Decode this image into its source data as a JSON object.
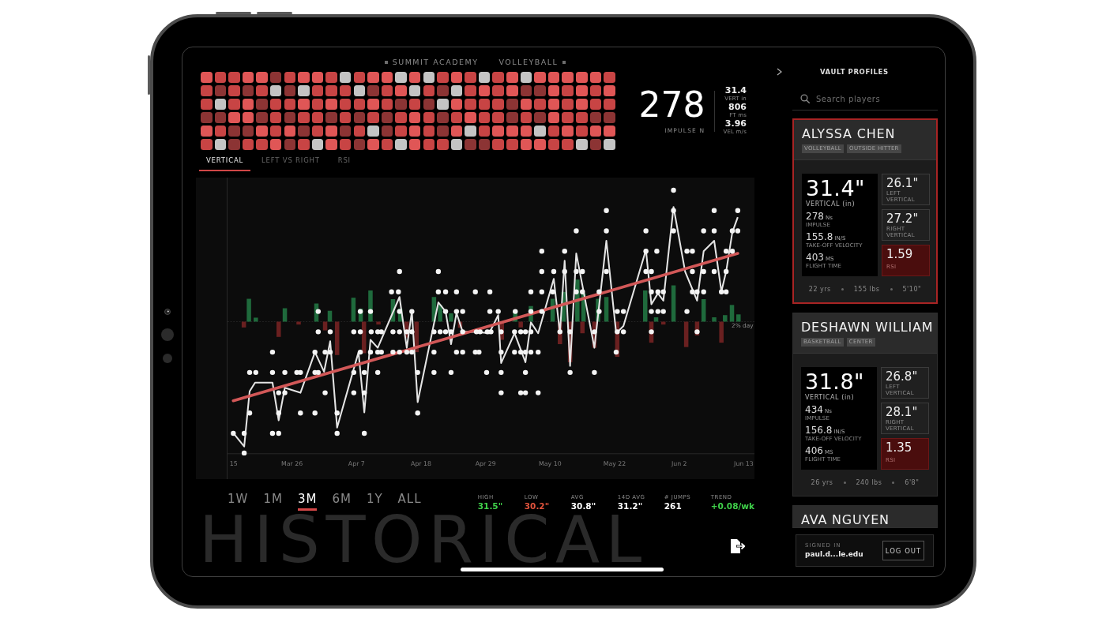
{
  "header": {
    "school": "SUMMIT ACADEMY",
    "sport": "VOLLEYBALL"
  },
  "heatmap": {
    "rows": [
      {
        "cells": [
          {
            "color": "#e05656"
          },
          {
            "color": "#c84444"
          },
          {
            "color": "#c84444"
          },
          {
            "color": "#e05656"
          },
          {
            "color": "#e05656"
          },
          {
            "color": "#8c3434"
          },
          {
            "color": "#c84444"
          },
          {
            "color": "#e05656"
          },
          {
            "color": "#e05656"
          },
          {
            "color": "#c84444"
          },
          {
            "color": "#c4c4c4"
          },
          {
            "color": "#c84444"
          },
          {
            "color": "#e05656"
          },
          {
            "color": "#e05656"
          },
          {
            "color": "#c4c4c4"
          },
          {
            "color": "#e05656"
          },
          {
            "color": "#c4c4c4"
          },
          {
            "color": "#c84444"
          },
          {
            "color": "#e05656"
          },
          {
            "color": "#c84444"
          },
          {
            "color": "#c4c4c4"
          },
          {
            "color": "#c84444"
          },
          {
            "color": "#e05656"
          },
          {
            "color": "#c4c4c4"
          },
          {
            "color": "#e05656"
          },
          {
            "color": "#e05656"
          },
          {
            "color": "#e05656"
          },
          {
            "color": "#e05656"
          },
          {
            "color": "#e05656"
          },
          {
            "color": "#c84444"
          }
        ]
      },
      {
        "cells": [
          {
            "color": "#c84444"
          },
          {
            "color": "#8c3434"
          },
          {
            "color": "#c84444"
          },
          {
            "color": "#8c3434"
          },
          {
            "color": "#c84444"
          },
          {
            "color": "#c4c4c4"
          },
          {
            "color": "#8c3434"
          },
          {
            "color": "#c4c4c4"
          },
          {
            "color": "#c84444"
          },
          {
            "color": "#c84444"
          },
          {
            "color": "#c84444"
          },
          {
            "color": "#c4c4c4"
          },
          {
            "color": "#8c3434"
          },
          {
            "color": "#c84444"
          },
          {
            "color": "#e05656"
          },
          {
            "color": "#c4c4c4"
          },
          {
            "color": "#c84444"
          },
          {
            "color": "#8c3434"
          },
          {
            "color": "#c4c4c4"
          },
          {
            "color": "#c84444"
          },
          {
            "color": "#e05656"
          },
          {
            "color": "#c84444"
          },
          {
            "color": "#e05656"
          },
          {
            "color": "#8c3434"
          },
          {
            "color": "#8c3434"
          },
          {
            "color": "#e05656"
          },
          {
            "color": "#c84444"
          },
          {
            "color": "#e05656"
          },
          {
            "color": "#c84444"
          },
          {
            "color": "#e05656"
          }
        ]
      },
      {
        "cells": [
          {
            "color": "#c84444"
          },
          {
            "color": "#c4c4c4"
          },
          {
            "color": "#c84444"
          },
          {
            "color": "#e05656"
          },
          {
            "color": "#8c3434"
          },
          {
            "color": "#c84444"
          },
          {
            "color": "#c84444"
          },
          {
            "color": "#e05656"
          },
          {
            "color": "#c84444"
          },
          {
            "color": "#e05656"
          },
          {
            "color": "#c84444"
          },
          {
            "color": "#c84444"
          },
          {
            "color": "#e05656"
          },
          {
            "color": "#c84444"
          },
          {
            "color": "#8c3434"
          },
          {
            "color": "#c84444"
          },
          {
            "color": "#8c3434"
          },
          {
            "color": "#c4c4c4"
          },
          {
            "color": "#e05656"
          },
          {
            "color": "#c84444"
          },
          {
            "color": "#c84444"
          },
          {
            "color": "#c84444"
          },
          {
            "color": "#8c3434"
          },
          {
            "color": "#e05656"
          },
          {
            "color": "#c84444"
          },
          {
            "color": "#e05656"
          },
          {
            "color": "#c84444"
          },
          {
            "color": "#e05656"
          },
          {
            "color": "#c84444"
          },
          {
            "color": "#c84444"
          }
        ]
      },
      {
        "cells": [
          {
            "color": "#8c3434"
          },
          {
            "color": "#8c3434"
          },
          {
            "color": "#e05656"
          },
          {
            "color": "#e05656"
          },
          {
            "color": "#8c3434"
          },
          {
            "color": "#c84444"
          },
          {
            "color": "#8c3434"
          },
          {
            "color": "#c84444"
          },
          {
            "color": "#c84444"
          },
          {
            "color": "#8c3434"
          },
          {
            "color": "#c84444"
          },
          {
            "color": "#8c3434"
          },
          {
            "color": "#c84444"
          },
          {
            "color": "#8c3434"
          },
          {
            "color": "#c84444"
          },
          {
            "color": "#e05656"
          },
          {
            "color": "#c84444"
          },
          {
            "color": "#8c3434"
          },
          {
            "color": "#c84444"
          },
          {
            "color": "#e05656"
          },
          {
            "color": "#c84444"
          },
          {
            "color": "#c84444"
          },
          {
            "color": "#8c3434"
          },
          {
            "color": "#c84444"
          },
          {
            "color": "#8c3434"
          },
          {
            "color": "#e05656"
          },
          {
            "color": "#c84444"
          },
          {
            "color": "#c84444"
          },
          {
            "color": "#8c3434"
          },
          {
            "color": "#8c3434"
          }
        ]
      },
      {
        "cells": [
          {
            "color": "#e05656"
          },
          {
            "color": "#c84444"
          },
          {
            "color": "#8c3434"
          },
          {
            "color": "#8c3434"
          },
          {
            "color": "#e05656"
          },
          {
            "color": "#c84444"
          },
          {
            "color": "#e05656"
          },
          {
            "color": "#8c3434"
          },
          {
            "color": "#c84444"
          },
          {
            "color": "#e05656"
          },
          {
            "color": "#8c3434"
          },
          {
            "color": "#c84444"
          },
          {
            "color": "#c4c4c4"
          },
          {
            "color": "#8c3434"
          },
          {
            "color": "#c84444"
          },
          {
            "color": "#e05656"
          },
          {
            "color": "#c84444"
          },
          {
            "color": "#8c3434"
          },
          {
            "color": "#e05656"
          },
          {
            "color": "#c4c4c4"
          },
          {
            "color": "#c84444"
          },
          {
            "color": "#e05656"
          },
          {
            "color": "#e05656"
          },
          {
            "color": "#e05656"
          },
          {
            "color": "#c4c4c4"
          },
          {
            "color": "#c84444"
          },
          {
            "color": "#e05656"
          },
          {
            "color": "#c84444"
          },
          {
            "color": "#e05656"
          },
          {
            "color": "#e05656"
          }
        ]
      },
      {
        "cells": [
          {
            "color": "#c84444"
          },
          {
            "color": "#c4c4c4"
          },
          {
            "color": "#8c3434"
          },
          {
            "color": "#c84444"
          },
          {
            "color": "#c84444"
          },
          {
            "color": "#e05656"
          },
          {
            "color": "#8c3434"
          },
          {
            "color": "#c84444"
          },
          {
            "color": "#c4c4c4"
          },
          {
            "color": "#e05656"
          },
          {
            "color": "#c84444"
          },
          {
            "color": "#8c3434"
          },
          {
            "color": "#e05656"
          },
          {
            "color": "#c84444"
          },
          {
            "color": "#c4c4c4"
          },
          {
            "color": "#e05656"
          },
          {
            "color": "#c84444"
          },
          {
            "color": "#c84444"
          },
          {
            "color": "#c4c4c4"
          },
          {
            "color": "#8c3434"
          },
          {
            "color": "#8c3434"
          },
          {
            "color": "#c84444"
          },
          {
            "color": "#c84444"
          },
          {
            "color": "#e05656"
          },
          {
            "color": "#e05656"
          },
          {
            "color": "#c84444"
          },
          {
            "color": "#c84444"
          },
          {
            "color": "#c4c4c4"
          },
          {
            "color": "#8c3434"
          },
          {
            "color": "#c4c4c4"
          }
        ]
      }
    ]
  },
  "summary": {
    "value": "278",
    "label": "IMPULSE N",
    "metrics": [
      {
        "value": "31.4",
        "label": "VERT in"
      },
      {
        "value": "806",
        "label": "FT ms"
      },
      {
        "value": "3.96",
        "label": "VEL m/s"
      }
    ]
  },
  "tabs": [
    {
      "label": "VERTICAL",
      "selected": true
    },
    {
      "label": "LEFT VS RIGHT",
      "selected": false
    },
    {
      "label": "RSI",
      "selected": false
    }
  ],
  "chart": {
    "x_labels": [
      "15",
      "Mar 26",
      "Apr 7",
      "Apr 18",
      "Apr 29",
      "May 10",
      "May 22",
      "Jun 2",
      "Jun 13"
    ],
    "baseline_label": "2% day"
  },
  "ranges": [
    {
      "label": "1W",
      "selected": false
    },
    {
      "label": "1M",
      "selected": false
    },
    {
      "label": "3M",
      "selected": true
    },
    {
      "label": "6M",
      "selected": false
    },
    {
      "label": "1Y",
      "selected": false
    },
    {
      "label": "ALL",
      "selected": false
    }
  ],
  "stats": [
    {
      "label": "HIGH",
      "value": "31.5\"",
      "color": "#3fd04a"
    },
    {
      "label": "LOW",
      "value": "30.2\"",
      "color": "#e2533c"
    },
    {
      "label": "AVG",
      "value": "30.8\"",
      "color": "#ffffff"
    },
    {
      "label": "14D AVG",
      "value": "31.2\"",
      "color": "#ffffff"
    },
    {
      "label": "# JUMPS",
      "value": "261",
      "color": "#ffffff"
    },
    {
      "label": "TREND",
      "value": "+0.08/wk",
      "color": "#3fd04a"
    }
  ],
  "section_title": "HISTORICAL",
  "sidebar": {
    "title": "VAULT PROFILES",
    "search": {
      "placeholder": "Search players"
    },
    "profiles": [
      {
        "name": "ALYSSA CHEN",
        "selected": true,
        "tags": [
          "VOLLEYBALL",
          "OUTSIDE HITTER"
        ],
        "vertical": {
          "value": "31.4\"",
          "label": "VERTICAL (in)"
        },
        "metrics": [
          {
            "value": "278",
            "unit": "Ns",
            "label": "IMPULSE"
          },
          {
            "value": "155.8",
            "unit": "IN/S",
            "label": "TAKE-OFF VELOCITY"
          },
          {
            "value": "403",
            "unit": "MS",
            "label": "FLIGHT TIME"
          }
        ],
        "tiles": [
          {
            "kind": "plain",
            "value": "26.1\"",
            "label": "LEFT VERTICAL"
          },
          {
            "kind": "plain",
            "value": "27.2\"",
            "label": "RIGHT VERTICAL"
          },
          {
            "kind": "alert",
            "value": "1.59",
            "label": "RSI"
          }
        ],
        "facts": [
          "22 yrs",
          "155 lbs",
          "5'10\""
        ]
      },
      {
        "name": "DESHAWN WILLIAM",
        "selected": false,
        "tags": [
          "BASKETBALL",
          "CENTER"
        ],
        "vertical": {
          "value": "31.8\"",
          "label": "VERTICAL (in)"
        },
        "metrics": [
          {
            "value": "434",
            "unit": "Ns",
            "label": "IMPULSE"
          },
          {
            "value": "156.8",
            "unit": "IN/S",
            "label": "TAKE-OFF VELOCITY"
          },
          {
            "value": "406",
            "unit": "MS",
            "label": "FLIGHT TIME"
          }
        ],
        "tiles": [
          {
            "kind": "plain",
            "value": "26.8\"",
            "label": "LEFT VERTICAL"
          },
          {
            "kind": "plain",
            "value": "28.1\"",
            "label": "RIGHT VERTICAL"
          },
          {
            "kind": "alert",
            "value": "1.35",
            "label": "RSI"
          }
        ],
        "facts": [
          "26 yrs",
          "240 lbs",
          "6'8\""
        ]
      },
      {
        "name": "AVA NGUYEN",
        "selected": false
      }
    ],
    "account": {
      "label": "SIGNED IN",
      "email": "paul.d...le.edu",
      "button": "LOG OUT"
    }
  }
}
